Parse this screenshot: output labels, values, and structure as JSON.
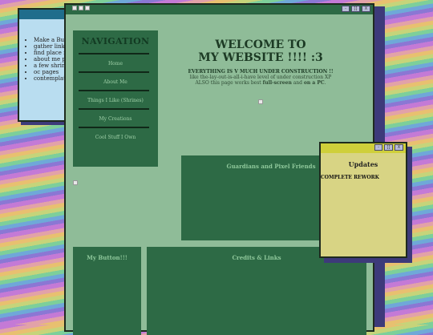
{
  "window_controls": {
    "minimize": "-",
    "restore": "[]",
    "close": "X"
  },
  "list_window": {
    "items": [
      "Make a Button",
      "gather links and",
      "find place for p",
      "about me page",
      "a few shrines",
      "oc pages",
      "contemplate ad"
    ]
  },
  "nav": {
    "heading": "NAVIGATION",
    "items": [
      "Home",
      "About Me",
      "Things I Like (Shrines)",
      "My Creations",
      "Cool Stuff I Own"
    ]
  },
  "welcome": {
    "title_line1": "WELCOME TO",
    "title_line2": "MY WEBSITE !!!! :3",
    "notice": "EVERYTHING IS V MUCH UNDER CONSTRUCTION !!",
    "sub_line1": "like the-lay-out-is-all-i-have level of under construction XP",
    "sub_line2_prefix": "ALSO this page works best ",
    "sub_line2_bold1": "full-screen",
    "sub_line2_mid": " and ",
    "sub_line2_bold2": "on a PC",
    "sub_line2_end": "."
  },
  "panels": {
    "guardians": "Guardians and Pixel Friends",
    "my_button": "My Button!!!",
    "credits": "Credits & Links"
  },
  "updates": {
    "title": "Updates",
    "entry": "COMPLETE REWORK"
  }
}
